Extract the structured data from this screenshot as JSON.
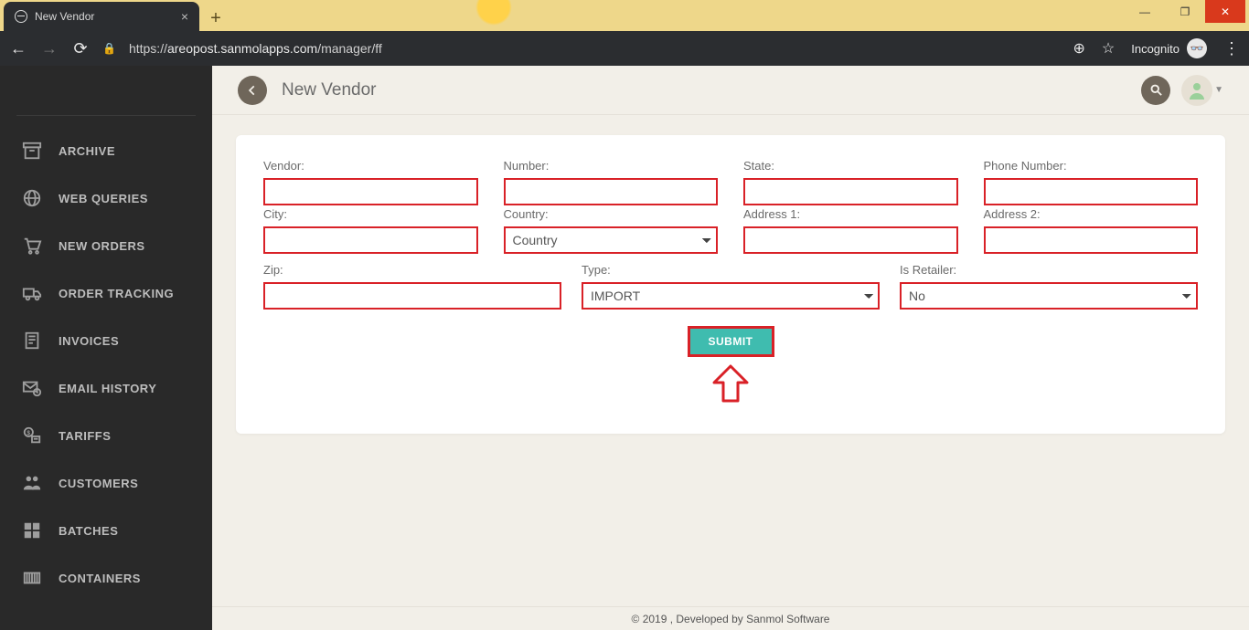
{
  "browser": {
    "tab_title": "New Vendor",
    "url_prefix": "https://",
    "url_host": "areopost.sanmolapps.com",
    "url_path": "/manager/ff",
    "incognito_label": "Incognito"
  },
  "sidebar": {
    "items": [
      {
        "label": "ARCHIVE"
      },
      {
        "label": "WEB QUERIES"
      },
      {
        "label": "NEW ORDERS"
      },
      {
        "label": "ORDER TRACKING"
      },
      {
        "label": "INVOICES"
      },
      {
        "label": "EMAIL HISTORY"
      },
      {
        "label": "TARIFFS"
      },
      {
        "label": "CUSTOMERS"
      },
      {
        "label": "BATCHES"
      },
      {
        "label": "CONTAINERS"
      }
    ]
  },
  "header": {
    "title": "New Vendor"
  },
  "form": {
    "labels": {
      "vendor": "Vendor:",
      "number": "Number:",
      "state": "State:",
      "phone": "Phone Number:",
      "city": "City:",
      "country": "Country:",
      "address1": "Address 1:",
      "address2": "Address 2:",
      "zip": "Zip:",
      "type": "Type:",
      "is_retailer": "Is Retailer:"
    },
    "values": {
      "vendor": "",
      "number": "",
      "state": "",
      "phone": "",
      "city": "",
      "country": "Country",
      "address1": "",
      "address2": "",
      "zip": "",
      "type": "IMPORT",
      "is_retailer": "No"
    },
    "submit_label": "SUBMIT"
  },
  "footer": {
    "text": "© 2019 , Developed by Sanmol Software"
  }
}
